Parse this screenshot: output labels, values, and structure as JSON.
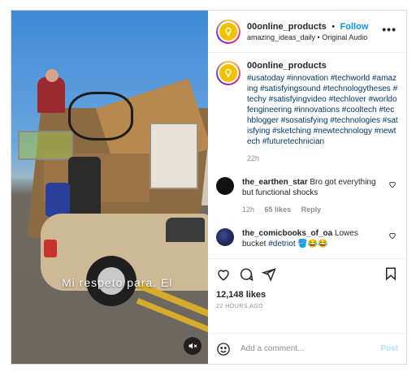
{
  "media": {
    "overlay_text": "Mi  respeto para. El",
    "mute_icon": "speaker-muted-icon"
  },
  "header": {
    "username": "00online_products",
    "separator": "•",
    "follow_label": "Follow",
    "audio_line": "amazing_ideas_daily • Original Audio",
    "more_icon": "more-horizontal-icon"
  },
  "caption": {
    "username": "00online_products",
    "hashtags": "#usatoday #innovation #techworld #amazing #satisfyingsound #technologytheses #techy #satisfyingvideo #techlover #worldofengineering #innovations #cooltech #techblogger #sosatisfying #technologies #satisfying #sketching #newtechnology #newtech #futuretechnician",
    "time": "22h"
  },
  "comments": [
    {
      "username": "the_earthen_star",
      "text": "Bro got everything but functional shocks",
      "time": "12h",
      "likes": "65 likes",
      "reply": "Reply"
    },
    {
      "username": "the_comicbooks_of_oa",
      "text": "Lowes bucket",
      "tag": "#detriot",
      "emoji": "🪣😂😂",
      "time": "",
      "likes": "",
      "reply": ""
    }
  ],
  "actions": {
    "likes": "12,148 likes",
    "posted": "22 HOURS AGO"
  },
  "composer": {
    "placeholder": "Add a comment...",
    "post_label": "Post"
  },
  "colors": {
    "accent": "#0095f6",
    "hashtag": "#00376b",
    "muted_text": "#8e8e8e",
    "post_disabled": "#b2dffc"
  }
}
